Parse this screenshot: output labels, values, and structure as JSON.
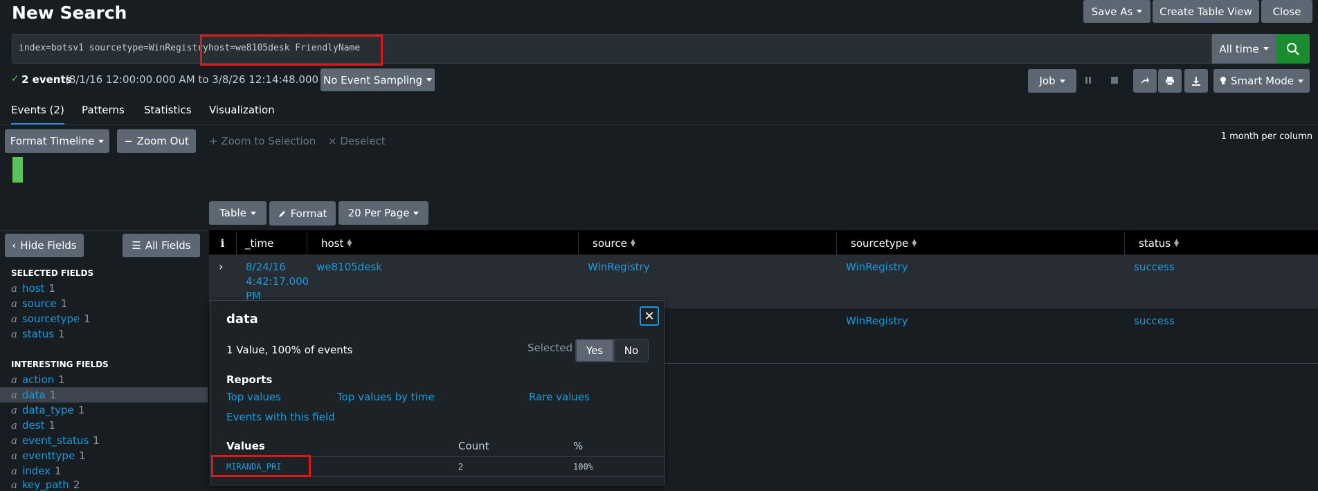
{
  "header": {
    "title": "New Search",
    "save_as": "Save As",
    "create_table_view": "Create Table View",
    "close": "Close"
  },
  "search": {
    "query_part1": "index=botsv1 sourcetype=WinRegistry",
    "query_part2": "host=we8105desk FriendlyName",
    "time_range": "All time"
  },
  "status": {
    "count": "2 events",
    "range": "(8/1/16 12:00:00.000 AM to 3/8/26 12:14:48.000 AM)",
    "sampling": "No Event Sampling",
    "job": "Job",
    "smart_mode": "Smart Mode"
  },
  "tabs": [
    "Events (2)",
    "Patterns",
    "Statistics",
    "Visualization"
  ],
  "timeline": {
    "format_timeline": "Format Timeline",
    "zoom_out": "Zoom Out",
    "zoom_to_selection": "Zoom to Selection",
    "deselect": "Deselect",
    "scale": "1 month per column"
  },
  "results_toolbar": {
    "table": "Table",
    "format": "Format",
    "per_page": "20 Per Page"
  },
  "sidebar": {
    "hide_fields": "Hide Fields",
    "all_fields": "All Fields",
    "selected_heading": "SELECTED FIELDS",
    "selected": [
      {
        "name": "host",
        "count": "1"
      },
      {
        "name": "source",
        "count": "1"
      },
      {
        "name": "sourcetype",
        "count": "1"
      },
      {
        "name": "status",
        "count": "1"
      }
    ],
    "interesting_heading": "INTERESTING FIELDS",
    "interesting": [
      {
        "name": "action",
        "count": "1"
      },
      {
        "name": "data",
        "count": "1"
      },
      {
        "name": "data_type",
        "count": "1"
      },
      {
        "name": "dest",
        "count": "1"
      },
      {
        "name": "event_status",
        "count": "1"
      },
      {
        "name": "eventtype",
        "count": "1"
      },
      {
        "name": "index",
        "count": "1"
      },
      {
        "name": "key_path",
        "count": "2"
      }
    ],
    "type_glyph": "a"
  },
  "table": {
    "info": "i",
    "columns": [
      "_time",
      "host",
      "source",
      "sourcetype",
      "status"
    ],
    "rows": [
      {
        "time_line1": "8/24/16",
        "time_line2": "4:42:17.000",
        "time_line3": "PM",
        "host": "we8105desk",
        "source": "WinRegistry",
        "sourcetype": "WinRegistry",
        "status": "success"
      },
      {
        "sourcetype": "WinRegistry",
        "status": "success"
      }
    ]
  },
  "popup": {
    "title": "data",
    "summary": "1 Value, 100% of events",
    "selected_label": "Selected",
    "yes": "Yes",
    "no": "No",
    "reports_heading": "Reports",
    "top_values": "Top values",
    "top_values_by_time": "Top values by time",
    "rare_values": "Rare values",
    "events_with_field": "Events with this field",
    "values_heading": "Values",
    "count_heading": "Count",
    "pct_heading": "%",
    "value": "MIRANDA_PRI",
    "value_count": "2",
    "value_pct": "100%"
  },
  "colors": {
    "accent": "#1a9bde",
    "search_button": "#1a8b2e",
    "highlight_box": "#e0161b",
    "timeline_bar": "#5cc05c"
  }
}
